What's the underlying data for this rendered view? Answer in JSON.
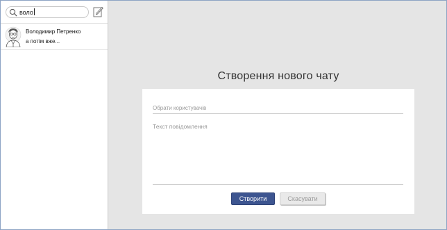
{
  "sidebar": {
    "search": {
      "value": "воло",
      "icon": "search-icon"
    },
    "compose": {
      "icon": "compose-icon"
    },
    "chats": [
      {
        "name": "Володимир Петренко",
        "preview": "а потім вже...",
        "avatar": "avatar-icon"
      }
    ]
  },
  "dialog": {
    "title": "Створення нового чату",
    "user_placeholder": "Обрати користувачів",
    "message_placeholder": "Текст повідомлення",
    "create_label": "Створити",
    "cancel_label": "Скасувати"
  },
  "colors": {
    "primary_button": "#3d5590",
    "background": "#e5e5e5",
    "frame_border": "#8da3c4"
  }
}
